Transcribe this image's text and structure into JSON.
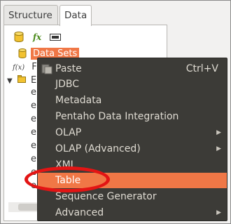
{
  "tabs": {
    "structure": "Structure",
    "data": "Data"
  },
  "toolbar": {
    "add_datasource_icon": "database-icon",
    "function_icon_text": "fx",
    "params_icon": "parameters-icon"
  },
  "tree": {
    "datasets_label": "Data Sets",
    "functions_label": "F",
    "params_label": "E",
    "leaf_items": [
      "e",
      "e",
      "e",
      "e",
      "e",
      "e",
      "e",
      "e"
    ]
  },
  "menu": {
    "items": [
      {
        "label": "Paste",
        "accelerator": "Ctrl+V",
        "icon": "paste-icon"
      },
      {
        "label": "JDBC"
      },
      {
        "label": "Metadata"
      },
      {
        "label": "Pentaho Data Integration"
      },
      {
        "label": "OLAP",
        "submenu": true
      },
      {
        "label": "OLAP (Advanced)",
        "submenu": true
      },
      {
        "label": "XML"
      },
      {
        "label": "Table",
        "highlighted": true
      },
      {
        "label": "Sequence Generator"
      },
      {
        "label": "Advanced",
        "submenu": true
      }
    ]
  },
  "colors": {
    "highlight": "#f07746",
    "menu_bg": "#3c3b37",
    "annotation_ellipse": "#e31414"
  }
}
